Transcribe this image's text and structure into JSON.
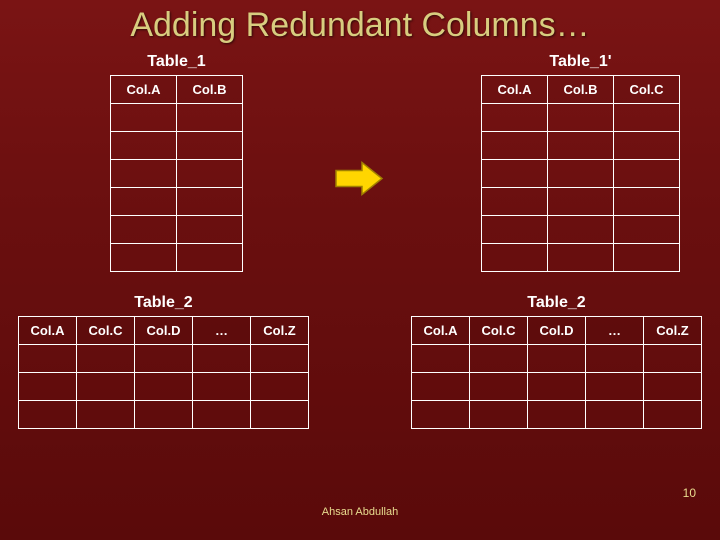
{
  "slide": {
    "title": "Adding Redundant Columns…",
    "footer_author": "Ahsan Abdullah",
    "slide_number": "10"
  },
  "tables": {
    "table1": {
      "label": "Table_1",
      "cols": [
        "Col.A",
        "Col.B"
      ],
      "empty_rows": 6
    },
    "table1p": {
      "label": "Table_1'",
      "cols": [
        "Col.A",
        "Col.B",
        "Col.C"
      ],
      "empty_rows": 6
    },
    "table2l": {
      "label": "Table_2",
      "cols": [
        "Col.A",
        "Col.C",
        "Col.D",
        "…",
        "Col.Z"
      ],
      "empty_rows": 3
    },
    "table2r": {
      "label": "Table_2",
      "cols": [
        "Col.A",
        "Col.C",
        "Col.D",
        "…",
        "Col.Z"
      ],
      "empty_rows": 3
    }
  },
  "arrow": {
    "color_fill": "#ffd600",
    "color_stroke": "#a08000"
  }
}
